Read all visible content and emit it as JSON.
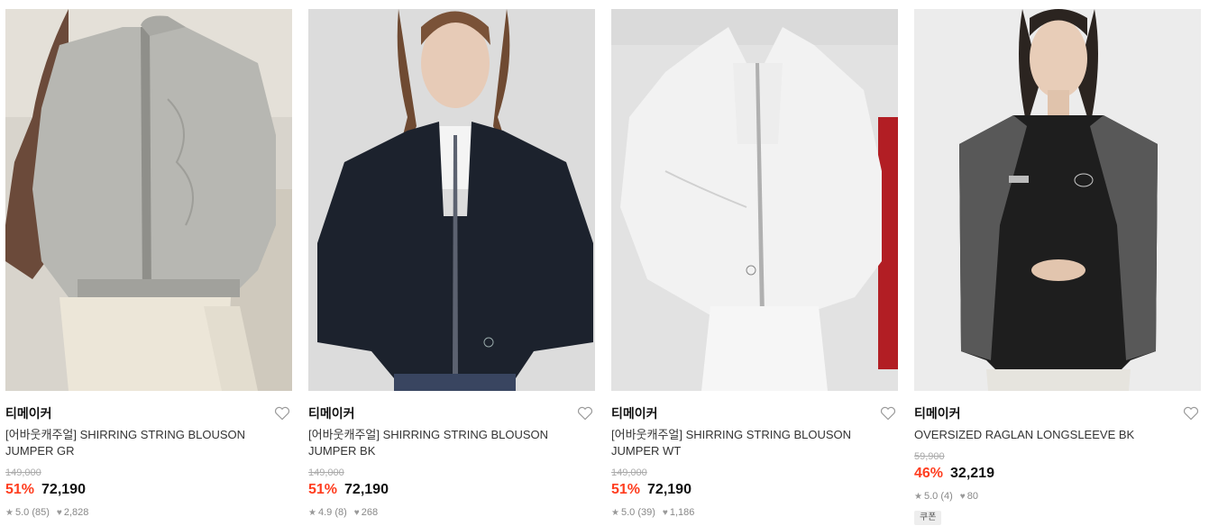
{
  "products": [
    {
      "brand": "티메이커",
      "name": "[어바웃캐주얼] SHIRRING STRING BLOUSON JUMPER GR",
      "original_price": "149,000",
      "discount": "51%",
      "price": "72,190",
      "rating": "5.0",
      "reviews": "(85)",
      "likes": "2,828",
      "image": "gray-jacket-photo",
      "jacket_color": "#b7b7b2",
      "bg_color": "#d8d4cc"
    },
    {
      "brand": "티메이커",
      "name": "[어바웃캐주얼] SHIRRING STRING BLOUSON JUMPER BK",
      "original_price": "149,000",
      "discount": "51%",
      "price": "72,190",
      "rating": "4.9",
      "reviews": "(8)",
      "likes": "268",
      "image": "black-jacket-photo",
      "jacket_color": "#1c222d",
      "bg_color": "#dcdcdc"
    },
    {
      "brand": "티메이커",
      "name": "[어바웃캐주얼] SHIRRING STRING BLOUSON JUMPER WT",
      "original_price": "149,000",
      "discount": "51%",
      "price": "72,190",
      "rating": "5.0",
      "reviews": "(39)",
      "likes": "1,186",
      "image": "white-jacket-photo",
      "jacket_color": "#f2f2f2",
      "bg_color": "#e2e2e2"
    },
    {
      "brand": "티메이커",
      "name": "OVERSIZED RAGLAN LONGSLEEVE BK",
      "original_price": "59,900",
      "discount": "46%",
      "price": "32,219",
      "rating": "5.0",
      "reviews": "(4)",
      "likes": "80",
      "coupon": "쿠폰",
      "image": "black-longsleeve-photo",
      "jacket_color": "#1e1e1e",
      "bg_color": "#ececec"
    }
  ],
  "colors": {
    "discount": "#ff3d1f",
    "strike": "#aaaaaa",
    "meta": "#888888"
  }
}
